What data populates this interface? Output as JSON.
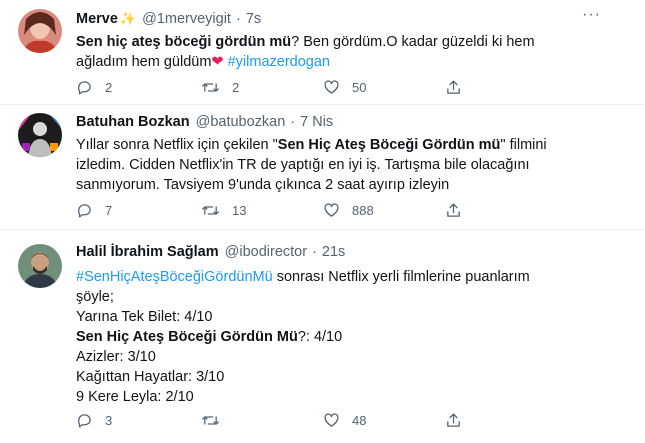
{
  "tweets": [
    {
      "name": "Merve",
      "name_emoji": "✨",
      "handle": "@1merveyigit",
      "time": "7s",
      "lines": {
        "l1_bold": "Sen hiç ateş böceği gördün mü",
        "l1_rest": "? Ben gördüm.O kadar güzeldi ki hem",
        "l2_text": "ağladım hem güldüm",
        "l2_heart": "❤",
        "l2_tag": "#yilmazerdogan"
      },
      "replies": "2",
      "retweets": "2",
      "likes": "50"
    },
    {
      "name": "Batuhan Bozkan",
      "handle": "@batubozkan",
      "time": "7 Nis",
      "lines": {
        "l1_pre": "Yıllar sonra Netflix için çekilen \"",
        "l1_bold": "Sen Hiç Ateş Böceği Gördün mü",
        "l1_post": "\" filmini",
        "l2": "izledim. Cidden Netflix'in TR de yaptığı en iyi iş. Tartışma bile olacağını",
        "l3": "sanmıyorum. Tavsiyem 9'unda çıkınca 2 saat ayırıp izleyin"
      },
      "replies": "7",
      "retweets": "13",
      "likes": "888"
    },
    {
      "name": "Halil İbrahim Sağlam",
      "handle": "@ibodirector",
      "time": "21s",
      "lines": {
        "l1_tag": "#SenHiçAteşBöceğiGördünMü",
        "l1_rest": " sonrası Netflix yerli filmlerine puanlarım",
        "l2": "şöyle;",
        "l3": "Yarına Tek Bilet: 4/10",
        "l4_bold": "Sen Hiç Ateş Böceği Gördün Mü",
        "l4_rest": "?: 4/10",
        "l5": "Azizler: 3/10",
        "l6": "Kağıttan Hayatlar: 3/10",
        "l7": "9 Kere Leyla: 2/10"
      },
      "replies": "3",
      "retweets": "",
      "likes": "48"
    }
  ],
  "icons": {
    "reply": "reply-icon",
    "retweet": "retweet-icon",
    "like": "heart-icon",
    "share": "share-icon",
    "more": "more-icon"
  },
  "colors": {
    "link": "#1d9bf0",
    "secondary": "#536471",
    "heart": "#e0245e",
    "divider": "#eff3f4"
  }
}
